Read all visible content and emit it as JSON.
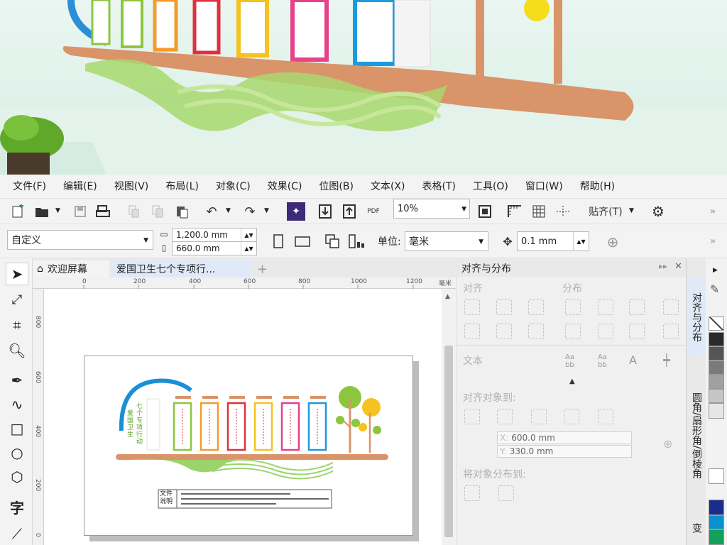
{
  "menu": [
    "文件(F)",
    "编辑(E)",
    "视图(V)",
    "布局(L)",
    "对象(C)",
    "效果(C)",
    "位图(B)",
    "文本(X)",
    "表格(T)",
    "工具(O)",
    "窗口(W)",
    "帮助(H)"
  ],
  "toolbar": {
    "zoom_value": "10%",
    "paste_label": "贴齐(T)",
    "pdf_label": "PDF"
  },
  "propbar": {
    "preset": "自定义",
    "width": "1,200.0 mm",
    "height": "660.0 mm",
    "unit_label": "单位:",
    "unit_value": "毫米",
    "nudge": "0.1 mm"
  },
  "tabs": {
    "welcome": "欢迎屏幕",
    "doc": "爱国卫生七个专项行..."
  },
  "ruler": {
    "unit": "毫米",
    "ticks": [
      "0",
      "200",
      "400",
      "600",
      "800",
      "1000",
      "1200"
    ],
    "vticks": [
      "800",
      "600",
      "400",
      "200",
      "0"
    ]
  },
  "artwork": {
    "title_lines": [
      "七个",
      "专项",
      "行动"
    ],
    "sub_lines": [
      "爱国",
      "卫生"
    ],
    "note_label_1": "文件",
    "note_label_2": "说明"
  },
  "docker": {
    "title": "对齐与分布",
    "align_label": "对齐",
    "distribute_label": "分布",
    "text_label": "文本",
    "align_to_label": "对齐对象到:",
    "x_label": "X:",
    "x_value": "600.0 mm",
    "y_label": "Y:",
    "y_value": "330.0 mm",
    "distribute_to_label": "将对象分布到:"
  },
  "side_tabs": [
    "对齐与分布",
    "圆角/扇形角/倒棱角",
    "变"
  ],
  "colors": {
    "accent": "#1a6fbf",
    "panel_bg": "#f0f0f0",
    "wood": "#d9946a",
    "green": "#9bd46a",
    "blue": "#1a8fd6"
  },
  "palette_colors": [
    "#ffffff",
    "#2a2a2a",
    "#555555",
    "#7a7a7a",
    "#a0a0a0",
    "#c5c5c5",
    "#e6e6e6",
    "#ffffff",
    "#1a2d8a",
    "#0a8fd0",
    "#12a05a"
  ]
}
